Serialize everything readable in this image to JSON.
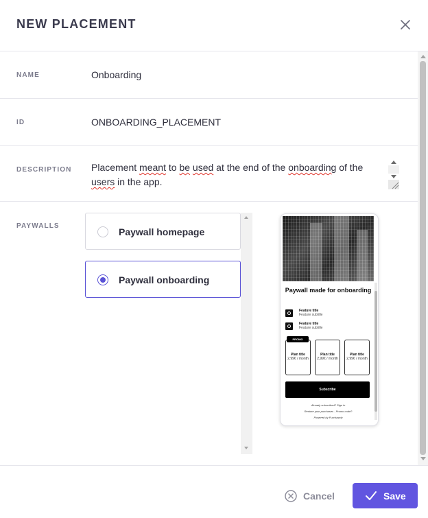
{
  "dialog": {
    "title": "NEW PLACEMENT",
    "close_icon": "close-icon"
  },
  "fields": {
    "name": {
      "label": "NAME",
      "value": "Onboarding"
    },
    "id": {
      "label": "ID",
      "value": "ONBOARDING_PLACEMENT"
    },
    "description": {
      "label": "DESCRIPTION",
      "parts": [
        "Placement ",
        "meant",
        " to ",
        "be",
        " ",
        "used",
        " at the end of the ",
        "onboarding",
        " of the ",
        "users",
        " in the app."
      ]
    },
    "paywalls": {
      "label": "PAYWALLS",
      "options": [
        {
          "label": "Paywall homepage",
          "selected": false
        },
        {
          "label": "Paywall onboarding",
          "selected": true
        }
      ]
    }
  },
  "preview": {
    "title": "Paywall made for onboarding",
    "features": [
      {
        "title": "Feature title",
        "subtitle": "Feature subtitle"
      },
      {
        "title": "Feature title",
        "subtitle": "Feature subtitle"
      }
    ],
    "promo": "PROMO",
    "plans": [
      {
        "title": "Plan title",
        "price": "2,99€ / month"
      },
      {
        "title": "Plan title",
        "price": "2,99€ / month"
      },
      {
        "title": "Plan title",
        "price": "2,99€ / month"
      }
    ],
    "subscribe": "Subscribe",
    "footer": [
      "Already subscribed? Sign in",
      "Restore your purchases - Promo code?",
      "Powered by Purchasely"
    ]
  },
  "actions": {
    "cancel": "Cancel",
    "save": "Save"
  },
  "colors": {
    "accent": "#6155e0",
    "selected_border": "#5a53d6"
  }
}
